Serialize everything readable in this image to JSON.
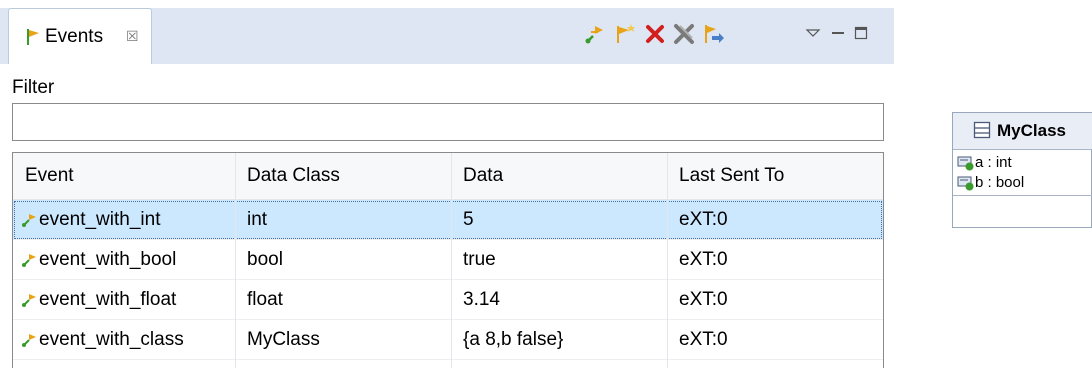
{
  "view": {
    "tab_title": "Events",
    "tab_close_glyph": "☒",
    "toolbar": [
      {
        "name": "send-event-icon",
        "tooltip": ""
      },
      {
        "name": "new-event-icon",
        "tooltip": ""
      },
      {
        "name": "delete-icon",
        "tooltip": ""
      },
      {
        "name": "delete-all-icon",
        "tooltip": ""
      },
      {
        "name": "export-events-icon",
        "tooltip": ""
      }
    ],
    "view_menu": [
      "view-menu-icon",
      "minimize-icon",
      "maximize-icon"
    ]
  },
  "filter": {
    "label": "Filter",
    "value": ""
  },
  "table": {
    "columns": [
      "Event",
      "Data Class",
      "Data",
      "Last Sent To"
    ],
    "rows": [
      {
        "event": "event_with_int",
        "data_class": "int",
        "data": "5",
        "last_sent_to": "eXT:0",
        "selected": true
      },
      {
        "event": "event_with_bool",
        "data_class": "bool",
        "data": "true",
        "last_sent_to": "eXT:0",
        "selected": false
      },
      {
        "event": "event_with_float",
        "data_class": "float",
        "data": "3.14",
        "last_sent_to": "eXT:0",
        "selected": false
      },
      {
        "event": "event_with_class",
        "data_class": "MyClass",
        "data": "{a 8,b false}",
        "last_sent_to": "eXT:0",
        "selected": false
      }
    ]
  },
  "class_box": {
    "name": "MyClass",
    "attributes": [
      "a : int",
      "b : bool"
    ]
  },
  "colors": {
    "tab_strip": "#dde6f2",
    "selection": "#cce8ff",
    "event_icon_green": "#3a9a2c",
    "event_icon_orange": "#e8a317",
    "delete_red": "#d21f1f"
  }
}
